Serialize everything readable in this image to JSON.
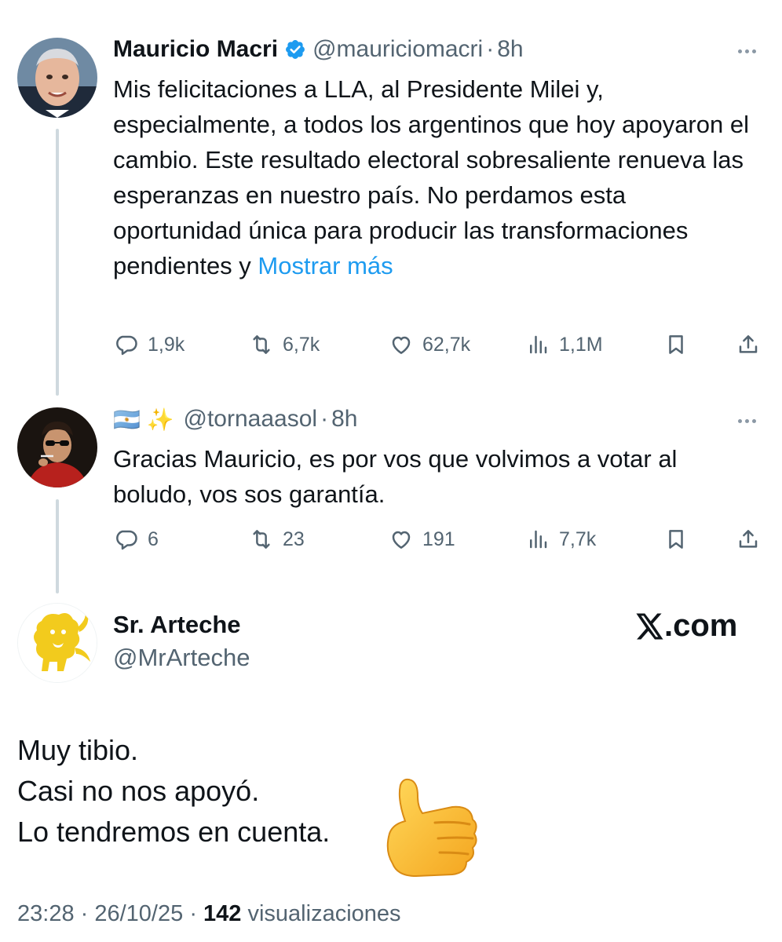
{
  "tweet1": {
    "name": "Mauricio Macri",
    "handle": "@mauriciomacri",
    "time": "8h",
    "text": "Mis felicitaciones a LLA, al Presidente Milei y, especialmente, a todos los argentinos que hoy apoyaron el cambio. Este resultado electoral sobresaliente renueva las esperanzas en nuestro país. No perdamos esta oportunidad única para producir las transformaciones pendientes y ",
    "show_more": "Mostrar más",
    "replies": "1,9k",
    "reposts": "6,7k",
    "likes": "62,7k",
    "views": "1,1M"
  },
  "tweet2": {
    "name_emoji": "🇦🇷 ✨",
    "handle": "@tornaaasol",
    "time": "8h",
    "text": "Gracias Mauricio, es por vos que volvimos a votar al boludo, vos sos garantía.",
    "replies": "6",
    "reposts": "23",
    "likes": "191",
    "views": "7,7k"
  },
  "quote": {
    "name": "Sr. Arteche",
    "handle": "@MrArteche",
    "site": ".com",
    "line1": "Muy tibio.",
    "line2": "Casi no nos apoyó.",
    "line3": "Lo tendremos en cuenta."
  },
  "footer": {
    "time": "23:28",
    "date": "26/10/25",
    "views_count": "142",
    "views_label": "visualizaciones"
  },
  "icons": [
    "verified-badge-icon",
    "reply-icon",
    "repost-icon",
    "like-icon",
    "views-icon",
    "bookmark-icon",
    "share-icon",
    "more-icon",
    "x-logo-icon",
    "thumbs-up-icon",
    "lion-icon"
  ],
  "colors": {
    "accent": "#1d9bf0",
    "muted": "#536471",
    "text": "#0f1419",
    "thread": "#cfd9de",
    "lion": "#f2cb1d"
  }
}
